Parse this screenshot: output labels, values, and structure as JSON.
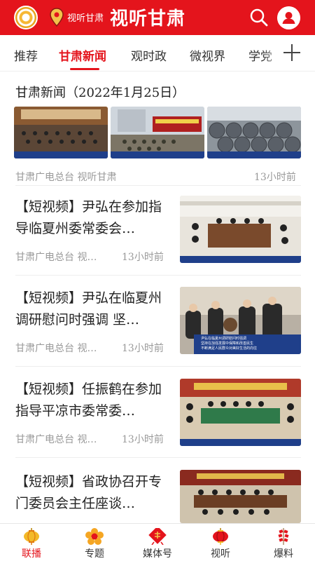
{
  "header": {
    "sub_label": "视听甘肃",
    "title": "视听甘肃"
  },
  "tabs": [
    {
      "label": "推荐",
      "active": false
    },
    {
      "label": "甘肃新闻",
      "active": true
    },
    {
      "label": "观时政",
      "active": false
    },
    {
      "label": "微视界",
      "active": false
    },
    {
      "label": "学党",
      "active": false
    }
  ],
  "feature": {
    "title": "甘肃新闻（2022年1月25日）",
    "source": "甘肃广电总台 视听甘肃",
    "time": "13小时前"
  },
  "articles": [
    {
      "title": "【短视频】尹弘在参加指导临夏州委常委会…",
      "source": "甘肃广电总台 视…",
      "time": "13小时前"
    },
    {
      "title": "【短视频】尹弘在临夏州调研慰问时强调 坚…",
      "source": "甘肃广电总台 视…",
      "time": "13小时前",
      "caption_lines": [
        "尹弘在临夏州调研慰问时强调",
        "坚持在加强发展中保障和改善民生",
        "不断满足人民群众对美好生活的向往"
      ]
    },
    {
      "title": "【短视频】任振鹤在参加指导平凉市委常委…",
      "source": "甘肃广电总台 视…",
      "time": "13小时前"
    },
    {
      "title": "【短视频】省政协召开专门委员会主任座谈…",
      "source": "",
      "time": ""
    }
  ],
  "bottom_nav": [
    {
      "label": "联播",
      "icon": "lantern-icon",
      "active": true
    },
    {
      "label": "专题",
      "icon": "flower-icon",
      "active": false
    },
    {
      "label": "媒体号",
      "icon": "fu-icon",
      "active": false
    },
    {
      "label": "视听",
      "icon": "lantern-icon",
      "active": false
    },
    {
      "label": "爆料",
      "icon": "firecracker-icon",
      "active": false
    }
  ],
  "colors": {
    "brand": "#e4141c",
    "meta": "#999999"
  }
}
